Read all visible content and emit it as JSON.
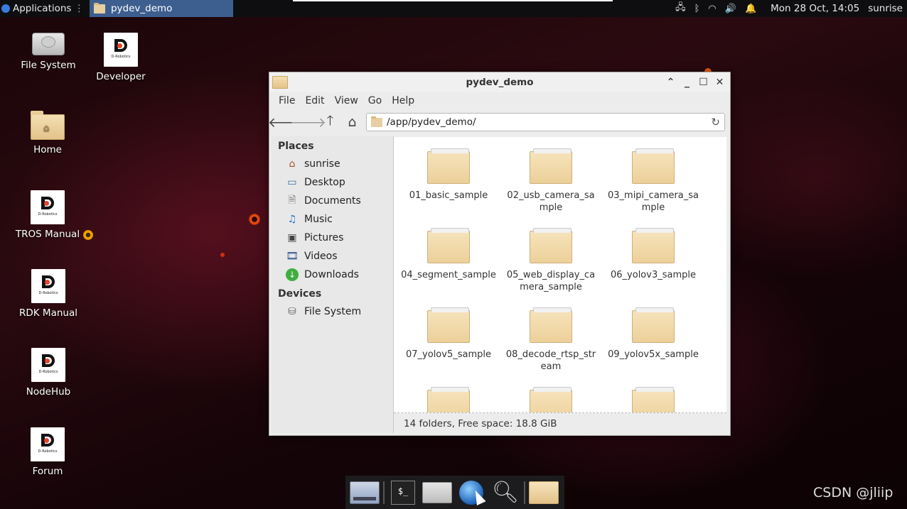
{
  "top_panel": {
    "applications_label": "Applications",
    "task_label": "pydev_demo",
    "clock": "Mon 28 Oct, 14:05",
    "user": "sunrise"
  },
  "desktop_icons": [
    {
      "label": "File System"
    },
    {
      "label": "Developer"
    },
    {
      "label": "Home"
    },
    {
      "label": "TROS Manual"
    },
    {
      "label": "RDK Manual"
    },
    {
      "label": "NodeHub"
    },
    {
      "label": "Forum"
    }
  ],
  "logo_text": "D-Robotics",
  "window": {
    "title": "pydev_demo",
    "menu": [
      "File",
      "Edit",
      "View",
      "Go",
      "Help"
    ],
    "address": "/app/pydev_demo/",
    "places_header": "Places",
    "places": [
      "sunrise",
      "Desktop",
      "Documents",
      "Music",
      "Pictures",
      "Videos",
      "Downloads"
    ],
    "devices_header": "Devices",
    "devices": [
      "File System"
    ],
    "files": [
      "01_basic_sample",
      "02_usb_camera_sample",
      "03_mipi_camera_sample",
      "04_segment_sample",
      "05_web_display_camera_sample",
      "06_yolov3_sample",
      "07_yolov5_sample",
      "08_decode_rtsp_stream",
      "09_yolov5x_sample",
      "",
      "",
      ""
    ],
    "status": "14 folders, Free space: 18.8 GiB"
  },
  "watermark": "CSDN @jliip"
}
